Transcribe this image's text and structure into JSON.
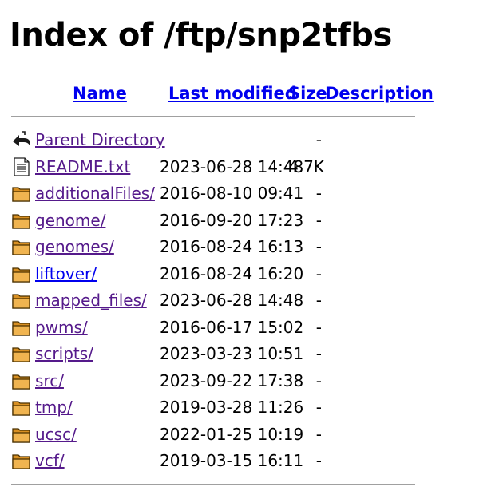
{
  "title": "Index of /ftp/snp2tfbs",
  "columns": {
    "name": "Name",
    "last_modified": "Last modified",
    "size": "Size",
    "description": "Description"
  },
  "rows": [
    {
      "icon": "back-arrow-icon",
      "name": "Parent Directory",
      "modified": "",
      "size": "-",
      "description": "",
      "link_state": "visited"
    },
    {
      "icon": "text-file-icon",
      "name": "README.txt",
      "modified": "2023-06-28 14:48",
      "size": "4.7K",
      "description": "",
      "link_state": "visited"
    },
    {
      "icon": "folder-icon",
      "name": "additionalFiles/",
      "modified": "2016-08-10 09:41",
      "size": "-",
      "description": "",
      "link_state": "visited"
    },
    {
      "icon": "folder-icon",
      "name": "genome/",
      "modified": "2016-09-20 17:23",
      "size": "-",
      "description": "",
      "link_state": "visited"
    },
    {
      "icon": "folder-icon",
      "name": "genomes/",
      "modified": "2016-08-24 16:13",
      "size": "-",
      "description": "",
      "link_state": "visited"
    },
    {
      "icon": "folder-icon",
      "name": "liftover/",
      "modified": "2016-08-24 16:20",
      "size": "-",
      "description": "",
      "link_state": "unvisited"
    },
    {
      "icon": "folder-icon",
      "name": "mapped_files/",
      "modified": "2023-06-28 14:48",
      "size": "-",
      "description": "",
      "link_state": "visited"
    },
    {
      "icon": "folder-icon",
      "name": "pwms/",
      "modified": "2016-06-17 15:02",
      "size": "-",
      "description": "",
      "link_state": "visited"
    },
    {
      "icon": "folder-icon",
      "name": "scripts/",
      "modified": "2023-03-23 10:51",
      "size": "-",
      "description": "",
      "link_state": "visited"
    },
    {
      "icon": "folder-icon",
      "name": "src/",
      "modified": "2023-09-22 17:38",
      "size": "-",
      "description": "",
      "link_state": "visited"
    },
    {
      "icon": "folder-icon",
      "name": "tmp/",
      "modified": "2019-03-28 11:26",
      "size": "-",
      "description": "",
      "link_state": "visited"
    },
    {
      "icon": "folder-icon",
      "name": "ucsc/",
      "modified": "2022-01-25 10:19",
      "size": "-",
      "description": "",
      "link_state": "visited"
    },
    {
      "icon": "folder-icon",
      "name": "vcf/",
      "modified": "2019-03-15 16:11",
      "size": "-",
      "description": "",
      "link_state": "visited"
    }
  ],
  "colors": {
    "link_unvisited": "#0000ee",
    "link_visited": "#551a8b",
    "rule": "#a0a0a0",
    "folder": "#e8a33b"
  }
}
